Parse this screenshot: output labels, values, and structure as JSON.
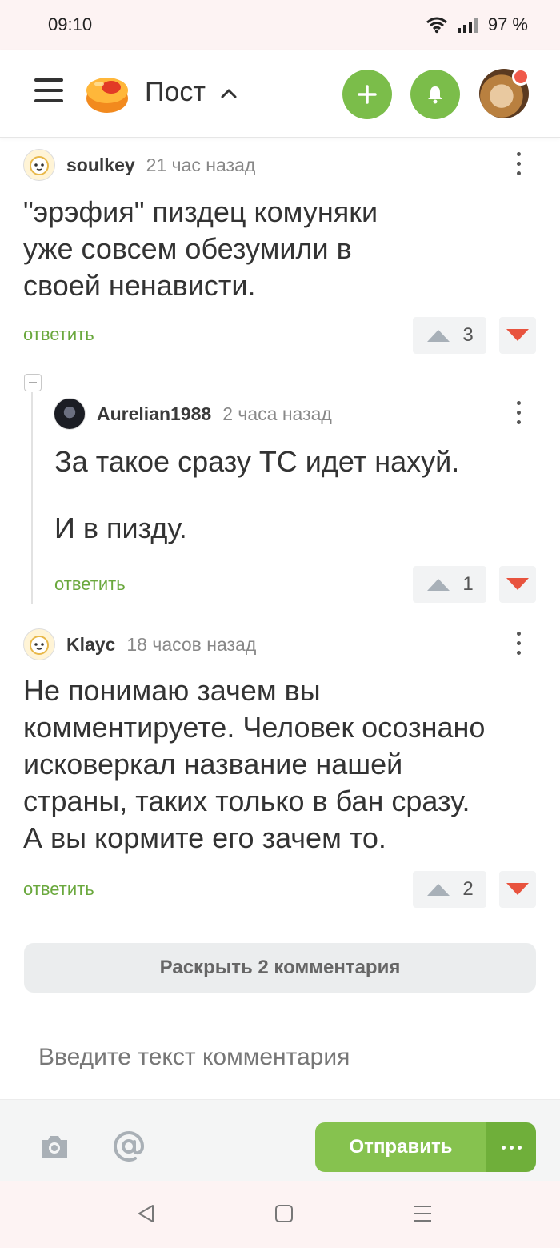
{
  "status_bar": {
    "time": "09:10",
    "battery": "97 %"
  },
  "header": {
    "title": "Пост",
    "accent_color": "#7bbd4a"
  },
  "comments": [
    {
      "author": "soulkey",
      "time": "21 час назад",
      "text_lines": [
        "\"эрэфия\" пиздец комуняки",
        "уже совсем обезумили в",
        "своей ненависти."
      ],
      "reply_label": "ответить",
      "score": "3"
    },
    {
      "author": "Aurelian1988",
      "time": "2 часа назад",
      "text_lines": [
        "За такое сразу ТС идет нахуй.",
        "",
        "И в пизду."
      ],
      "reply_label": "ответить",
      "score": "1"
    },
    {
      "author": "Klayc",
      "time": "18 часов назад",
      "text_lines": [
        "Не понимаю зачем вы",
        "комментируете. Человек осознано",
        "исковеркал название нашей",
        "страны, таких только в бан сразу.",
        "А вы кормите его зачем то."
      ],
      "reply_label": "ответить",
      "score": "2"
    }
  ],
  "expand_label": "Раскрыть 2 комментария",
  "composer": {
    "placeholder": "Введите текст комментария",
    "send_label": "Отправить"
  },
  "icons": [
    "menu-icon",
    "pikabu-logo",
    "chevron-up-icon",
    "plus-icon",
    "bell-icon",
    "camera-icon",
    "at-icon",
    "more-icon",
    "kebab-icon",
    "upvote-icon",
    "downvote-icon",
    "back-nav-icon",
    "home-nav-icon",
    "recents-nav-icon"
  ]
}
